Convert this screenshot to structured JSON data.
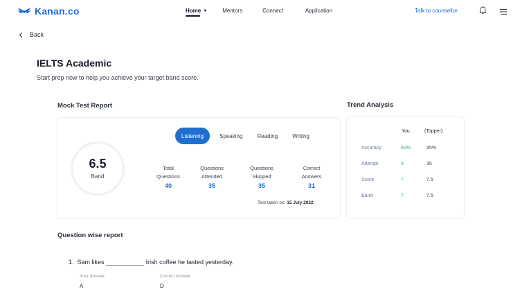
{
  "nav": {
    "brand": "Kanan.co",
    "links": [
      "Home",
      "Mentors",
      "Connect",
      "Application"
    ],
    "counsellor": "Talk to counsellor",
    "icons": {
      "bell": "bell-icon",
      "menu": "hamburger-menu-icon"
    },
    "colors": {
      "brand": "#1f6fd1"
    }
  },
  "back_label": "Back",
  "page": {
    "title": "IELTS Academic",
    "subtitle": "Start prep now to help you achieve your target band score."
  },
  "mock": {
    "title": "Mock Test Report",
    "band_value": "6.5",
    "band_label": "Band",
    "tabs": [
      "Listening",
      "Speaking",
      "Reading",
      "Writing"
    ],
    "active_tab": "Listening",
    "stats": [
      {
        "label_line1": "Total",
        "label_line2": "Questions",
        "value": "40"
      },
      {
        "label_line1": "Questions",
        "label_line2": "Attended",
        "value": "35"
      },
      {
        "label_line1": "Questions",
        "label_line2": "Skipped",
        "value": "35"
      },
      {
        "label_line1": "Correct",
        "label_line2": "Answers",
        "value": "31"
      }
    ],
    "taken_prefix": "Test taken on:",
    "taken_date": "15 July 2022"
  },
  "trend": {
    "title": "Trend Analysis",
    "col_you": "You",
    "col_topper": "(Topper)",
    "rows": [
      {
        "label": "Accuracy",
        "you": "60%",
        "topper": "95%",
        "you_color": "#2bb673"
      },
      {
        "label": "Attempt",
        "you": "5",
        "topper": "35",
        "you_color": "#2bb673"
      },
      {
        "label": "Score",
        "you": "7",
        "topper": "7.5",
        "you_color": "#2bb673"
      },
      {
        "label": "Band",
        "you": "7",
        "topper": "7.5",
        "you_color": "#2bb673"
      }
    ]
  },
  "questions": {
    "title": "Question wise report",
    "items": [
      {
        "number": "1.",
        "text": "Sam likes ___________ Irish coffee he tasted yesterday.",
        "your_answer_label": "Your Answer",
        "your_answer": "A",
        "correct_answer_label": "Correct Answer",
        "correct_answer": "D"
      }
    ]
  }
}
